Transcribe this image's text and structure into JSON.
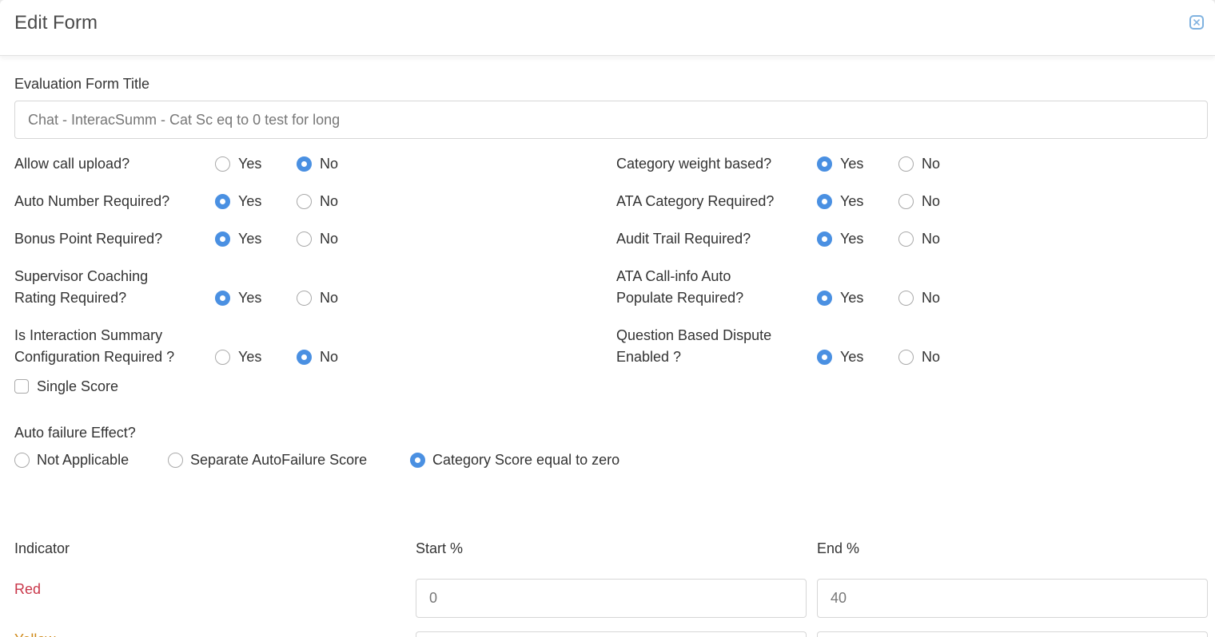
{
  "header": {
    "title": "Edit Form"
  },
  "form": {
    "title_label": "Evaluation Form Title",
    "title_value": "Chat - InteracSumm - Cat Sc eq to 0 test for long",
    "yes_label": "Yes",
    "no_label": "No",
    "left_options": [
      {
        "line1": "Allow call upload?",
        "line2": "",
        "selected": "no"
      },
      {
        "line1": "Auto Number Required?",
        "line2": "",
        "selected": "yes"
      },
      {
        "line1": "Bonus Point Required?",
        "line2": "",
        "selected": "yes"
      },
      {
        "line1": "Supervisor Coaching",
        "line2": "Rating Required?",
        "selected": "yes"
      },
      {
        "line1": "Is Interaction Summary",
        "line2": "Configuration Required ?",
        "selected": "no"
      }
    ],
    "right_options": [
      {
        "line1": "Category weight based?",
        "line2": "",
        "selected": "yes"
      },
      {
        "line1": "ATA Category Required?",
        "line2": "",
        "selected": "yes"
      },
      {
        "line1": "Audit Trail Required?",
        "line2": "",
        "selected": "yes"
      },
      {
        "line1": "ATA Call-info Auto",
        "line2": "Populate Required?",
        "selected": "yes"
      },
      {
        "line1": "Question Based Dispute",
        "line2": "Enabled ?",
        "selected": "yes"
      }
    ],
    "single_score_label": "Single Score",
    "single_score_checked": false,
    "auto_failure": {
      "label": "Auto failure Effect?",
      "options": [
        "Not Applicable",
        "Separate AutoFailure Score",
        "Category Score equal to zero"
      ],
      "selected_index": 2
    },
    "indicator": {
      "col_indicator": "Indicator",
      "col_start": "Start %",
      "col_end": "End %",
      "rows": [
        {
          "name": "Red",
          "color": "#c9374a",
          "start": "0",
          "end": "40"
        },
        {
          "name": "Yellow",
          "color": "#d08a1a",
          "start": "",
          "end": ""
        }
      ]
    }
  },
  "colors": {
    "accent": "#4a90e2",
    "red": "#c9374a",
    "yellow": "#d08a1a"
  }
}
